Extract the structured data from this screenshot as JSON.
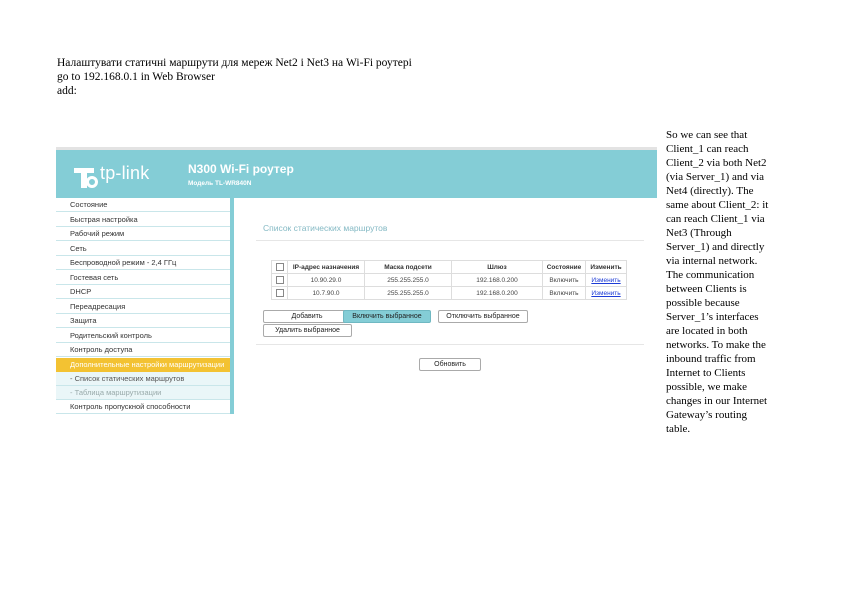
{
  "intro": {
    "line1": "Налаштувати статичні маршрути для мереж Net2 і Net3 на Wi-Fi роутері",
    "line2": "go to 192.168.0.1 in Web Browser",
    "line3": "add:"
  },
  "router": {
    "brand": "tp-link",
    "title": "N300 Wi-Fi роутер",
    "model": "Модель TL-WR840N",
    "accent_color": "#84cdd6",
    "active_color": "#f3c232",
    "menu": [
      "Состояние",
      "Быстрая настройка",
      "Рабочий режим",
      "Сеть",
      "Беспроводной режим - 2,4 ГГц",
      "Гостевая сеть",
      "DHCP",
      "Переадресация",
      "Защита",
      "Родительский контроль",
      "Контроль доступа",
      "Дополнительные настройки маршрутизации",
      "- Список статических маршрутов",
      "- Таблица маршрутизации",
      "Контроль пропускной способности"
    ],
    "panel_title": "Список статических маршрутов",
    "columns": [
      "IP-адрес назначения",
      "Маска подсети",
      "Шлюз",
      "Состояние",
      "Изменить"
    ],
    "rows": [
      {
        "ip": "10.90.29.0",
        "mask": "255.255.255.0",
        "gateway": "192.168.0.200",
        "state": "Включить",
        "edit": "Изменить"
      },
      {
        "ip": "10.7.90.0",
        "mask": "255.255.255.0",
        "gateway": "192.168.0.200",
        "state": "Включить",
        "edit": "Изменить"
      }
    ],
    "buttons": {
      "add": "Добавить",
      "enable_selected": "Включить выбранное",
      "disable_selected": "Отключить выбранное",
      "delete_selected": "Удалить выбранное",
      "refresh": "Обновить"
    }
  },
  "note": {
    "lines": [
      "So we can see that",
      " Client_1 can reach",
      " Client_2 via both Net2",
      " (via Server_1) and via",
      " Net4 (directly). The",
      " same about Client_2: it",
      " can reach Client_1 via",
      " Net3 (Through",
      " Server_1) and directly",
      " via internal network.",
      " The communication",
      " between Clients is",
      " possible because",
      " Server_1’s interfaces",
      " are located in both",
      " networks. To make the",
      " inbound traffic from",
      " Internet to Clients",
      " possible, we make",
      " changes in our Internet",
      " Gateway’s routing",
      "table."
    ]
  }
}
